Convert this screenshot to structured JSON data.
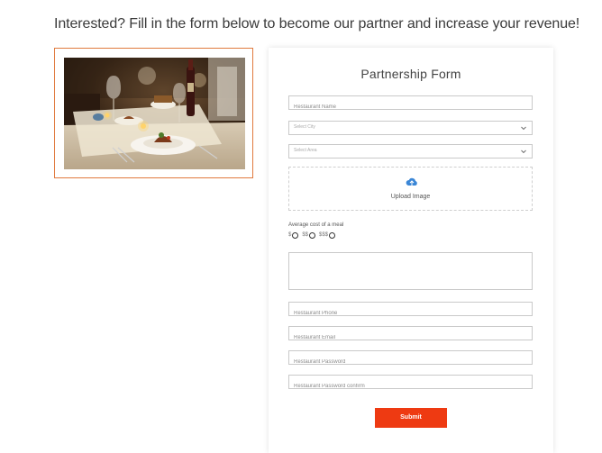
{
  "headline": "Interested? Fill in the form below to become our partner and increase your revenue!",
  "form": {
    "title": "Partnership Form",
    "restaurant_name_placeholder": "Restaurant Name",
    "city_select": "Select City",
    "area_select": "Select Area",
    "upload_label": "Upload Image",
    "cost_label": "Average cost of a meal",
    "cost_options": [
      "$",
      "$$",
      "$$$"
    ],
    "phone_placeholder": "Restaurant Phone",
    "email_placeholder": "Restaurant Email",
    "password_placeholder": "Restaurant Password",
    "password_confirm_placeholder": "Restaurant Password confirm",
    "submit_label": "Submit"
  },
  "colors": {
    "accent": "#ee3a12",
    "frame": "#e07a3e",
    "upload_icon": "#3a86d6"
  },
  "icons": [
    "upload-cloud-icon",
    "chevron-down-icon"
  ]
}
